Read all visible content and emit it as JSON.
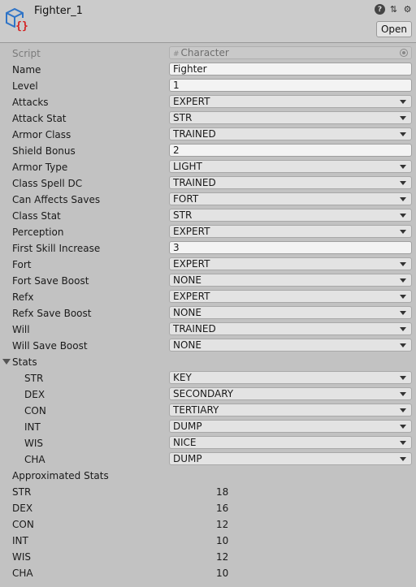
{
  "header": {
    "title": "Fighter_1",
    "open_label": "Open",
    "icon": "scriptable-object-icon"
  },
  "script_field": {
    "label": "Script",
    "value": "Character"
  },
  "fields": [
    {
      "label": "Name",
      "value": "Fighter",
      "kind": "text"
    },
    {
      "label": "Level",
      "value": "1",
      "kind": "text"
    },
    {
      "label": "Attacks",
      "value": "EXPERT",
      "kind": "enum"
    },
    {
      "label": "Attack Stat",
      "value": "STR",
      "kind": "enum"
    },
    {
      "label": "Armor Class",
      "value": "TRAINED",
      "kind": "enum"
    },
    {
      "label": "Shield Bonus",
      "value": "2",
      "kind": "text"
    },
    {
      "label": "Armor Type",
      "value": "LIGHT",
      "kind": "enum"
    },
    {
      "label": "Class Spell DC",
      "value": "TRAINED",
      "kind": "enum"
    },
    {
      "label": "Can Affects Saves",
      "value": "FORT",
      "kind": "enum"
    },
    {
      "label": "Class Stat",
      "value": "STR",
      "kind": "enum"
    },
    {
      "label": "Perception",
      "value": "EXPERT",
      "kind": "enum"
    },
    {
      "label": "First Skill Increase",
      "value": "3",
      "kind": "text"
    },
    {
      "label": "Fort",
      "value": "EXPERT",
      "kind": "enum"
    },
    {
      "label": "Fort Save Boost",
      "value": "NONE",
      "kind": "enum"
    },
    {
      "label": "Refx",
      "value": "EXPERT",
      "kind": "enum"
    },
    {
      "label": "Refx Save Boost",
      "value": "NONE",
      "kind": "enum"
    },
    {
      "label": "Will",
      "value": "TRAINED",
      "kind": "enum"
    },
    {
      "label": "Will Save Boost",
      "value": "NONE",
      "kind": "enum"
    }
  ],
  "stats": {
    "label": "Stats",
    "items": [
      {
        "label": "STR",
        "value": "KEY"
      },
      {
        "label": "DEX",
        "value": "SECONDARY"
      },
      {
        "label": "CON",
        "value": "TERTIARY"
      },
      {
        "label": "INT",
        "value": "DUMP"
      },
      {
        "label": "WIS",
        "value": "NICE"
      },
      {
        "label": "CHA",
        "value": "DUMP"
      }
    ]
  },
  "approx": {
    "label": "Approximated Stats",
    "items": [
      {
        "label": "STR",
        "value": "18"
      },
      {
        "label": "DEX",
        "value": "16"
      },
      {
        "label": "CON",
        "value": "12"
      },
      {
        "label": "INT",
        "value": "10"
      },
      {
        "label": "WIS",
        "value": "12"
      },
      {
        "label": "CHA",
        "value": "10"
      }
    ]
  }
}
